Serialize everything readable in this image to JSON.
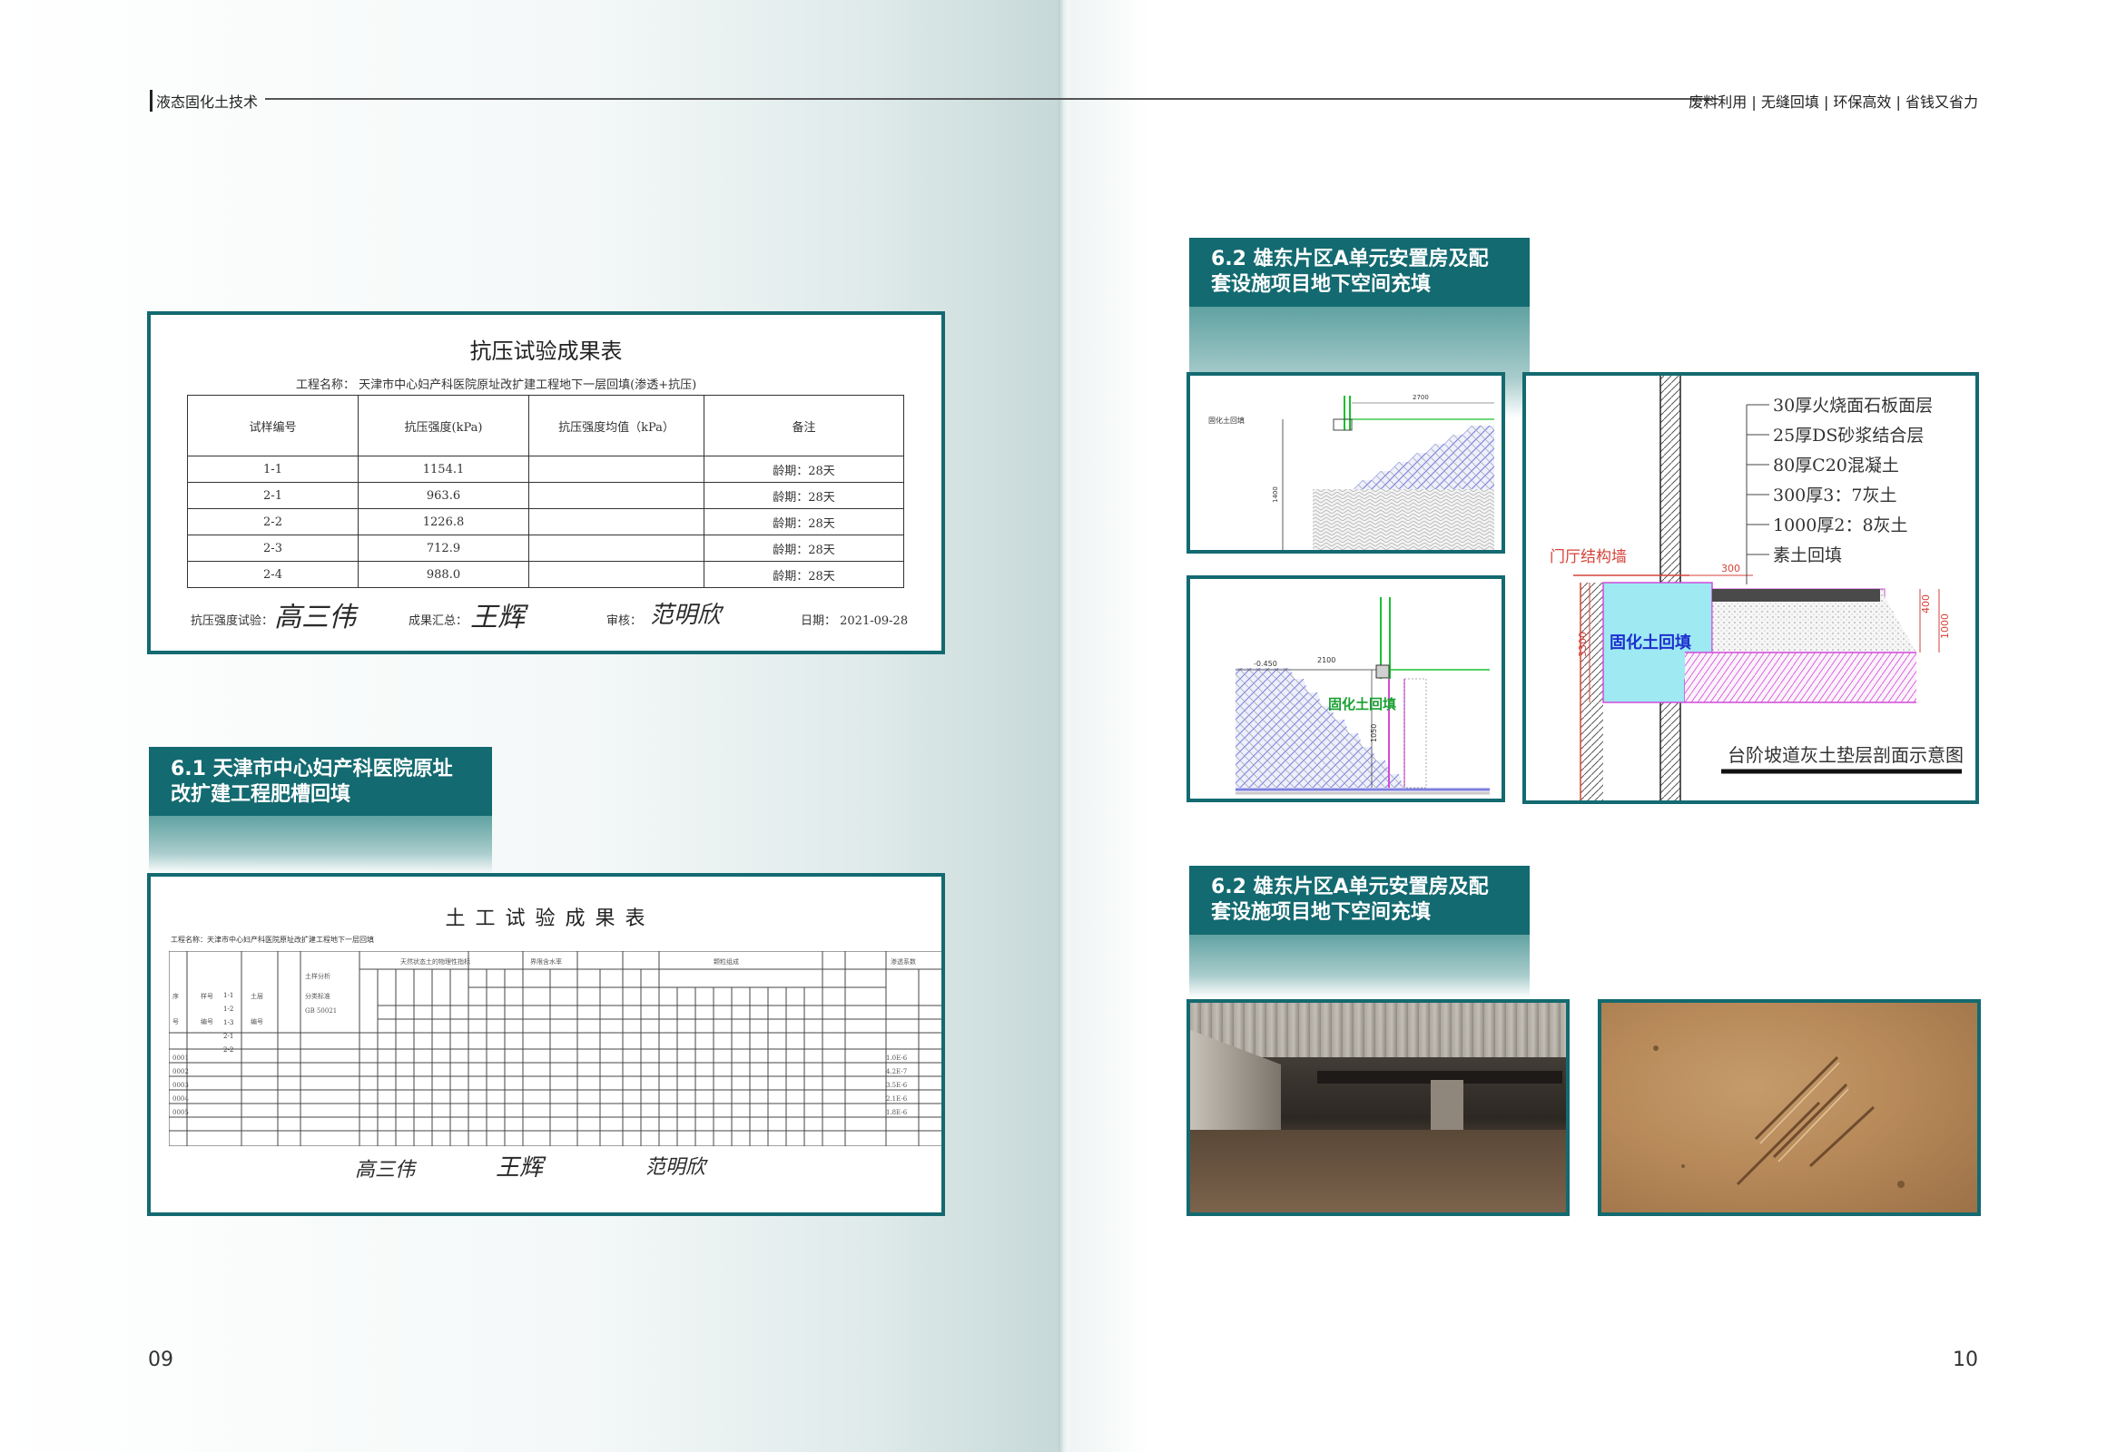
{
  "header": {
    "left_title": "液态固化土技术",
    "right_tagline": "废料利用 | 无缝回填 | 环保高效 | 省钱又省力"
  },
  "page_numbers": {
    "left": "09",
    "right": "10"
  },
  "compression_sheet": {
    "title": "抗压试验成果表",
    "project": "工程名称：  天津市中心妇产科医院原址改扩建工程地下一层回填(渗透+抗压)",
    "columns": [
      "试样编号",
      "抗压强度(kPa)",
      "抗压强度均值（kPa）",
      "备注"
    ],
    "rows": [
      {
        "id": "1-1",
        "strength": "1154.1",
        "mean": "",
        "note": "龄期：28天"
      },
      {
        "id": "2-1",
        "strength": "963.6",
        "mean": "",
        "note": "龄期：28天"
      },
      {
        "id": "2-2",
        "strength": "1226.8",
        "mean": "",
        "note": "龄期：28天"
      },
      {
        "id": "2-3",
        "strength": "712.9",
        "mean": "",
        "note": "龄期：28天"
      },
      {
        "id": "2-4",
        "strength": "988.0",
        "mean": "",
        "note": "龄期：28天"
      }
    ],
    "sign_test_label": "抗压强度试验：",
    "sign_test_name": "高三伟",
    "sign_summary_label": "成果汇总：",
    "sign_summary_name": "王辉",
    "sign_review_label": "审核：",
    "sign_review_name": "范明欣",
    "date": "日期：  2021-09-28"
  },
  "section_61": {
    "title": "6.1 天津市中心妇产科医院原址改扩建工程肥槽回填"
  },
  "soil_sheet": {
    "title": "土 工 试 验 成 果 表",
    "project_line": "工程名称：天津市中心妇产科医院原址改扩建工程地下一层回填",
    "sample_ids": [
      "1-1",
      "1-2",
      "1-3",
      "2-1",
      "2-2"
    ]
  },
  "section_62a": {
    "title": "6.2 雄东片区A单元安置房及配套设施项目地下空间充填"
  },
  "section_62b": {
    "title": "6.2 雄东片区A单元安置房及配套设施项目地下空间充填"
  },
  "drawing_small_1": {
    "label": "固化土回填",
    "dim_a": "2700",
    "dim_b": "1400"
  },
  "drawing_small_2": {
    "label": "固化土回填",
    "elev": "-0.450",
    "dim": "2100",
    "dim_v": "1050"
  },
  "drawing_large": {
    "layers": [
      "30厚火烧面石板面层",
      "25厚DS砂浆结合层",
      "80厚C20混凝土",
      "300厚3：7灰土",
      "1000厚2：8灰土",
      "素土回填"
    ],
    "wall_label": "门厅结构墙",
    "fill_label": "固化土回填",
    "dim_top": "300",
    "dim_left": "3300",
    "dim_right_1": "400",
    "dim_right_2": "1000",
    "caption": "台阶坡道灰土垫层剖面示意图"
  },
  "colors": {
    "teal": "#136a70",
    "fill_cyan": "#9ee9f2",
    "hatch": "#8e93e6",
    "magenta": "#d24ad9",
    "red": "#d6423a",
    "green": "#19c02f"
  }
}
